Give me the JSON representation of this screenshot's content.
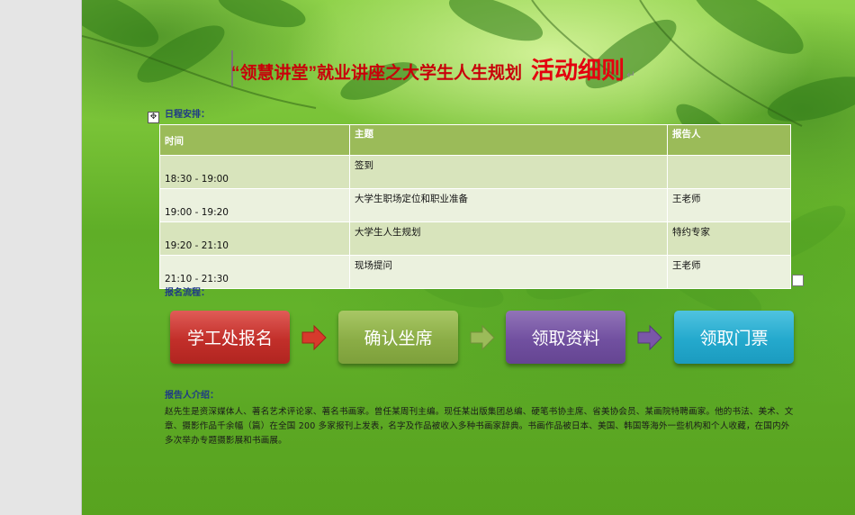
{
  "document": {
    "title_main": "“领慧讲堂”就业讲座之大学生人生规划",
    "title_emphasis": "活动细则"
  },
  "schedule": {
    "label": "日程安排：",
    "headers": {
      "time": "时间",
      "topic": "主题",
      "speaker": "报告人"
    },
    "rows": [
      {
        "time": "18:30 - 19:00",
        "topic": "签到",
        "speaker": ""
      },
      {
        "time": "19:00 - 19:20",
        "topic": "大学生职场定位和职业准备",
        "speaker": "王老师"
      },
      {
        "time": "19:20 - 21:10",
        "topic": "大学生人生规划",
        "speaker": "特约专家"
      },
      {
        "time": "21:10 - 21:30",
        "topic": "现场提问",
        "speaker": "王老师"
      }
    ]
  },
  "registration": {
    "label": "报名流程：",
    "steps": [
      "学工处报名",
      "确认坐席",
      "领取资料",
      "领取门票"
    ],
    "colors": {
      "step1": "#c22f2a",
      "step2": "#8bad46",
      "step3": "#7150a0",
      "step4": "#24a9cd"
    }
  },
  "speaker_intro": {
    "label": "报告人介绍：",
    "text": "赵先生是资深媒体人、著名艺术评论家、著名书画家。曾任某周刊主编。现任某出版集团总编、硬笔书协主席、省美协会员、某画院特聘画家。他的书法、美术、文章、摄影作品千余幅（篇）在全国 200 多家报刊上发表，名字及作品被收入多种书画家辞典。书画作品被日本、美国、韩国等海外一些机构和个人收藏，在国内外多次举办专题摄影展和书画展。"
  },
  "marks": {
    "paragraph": "↵"
  }
}
